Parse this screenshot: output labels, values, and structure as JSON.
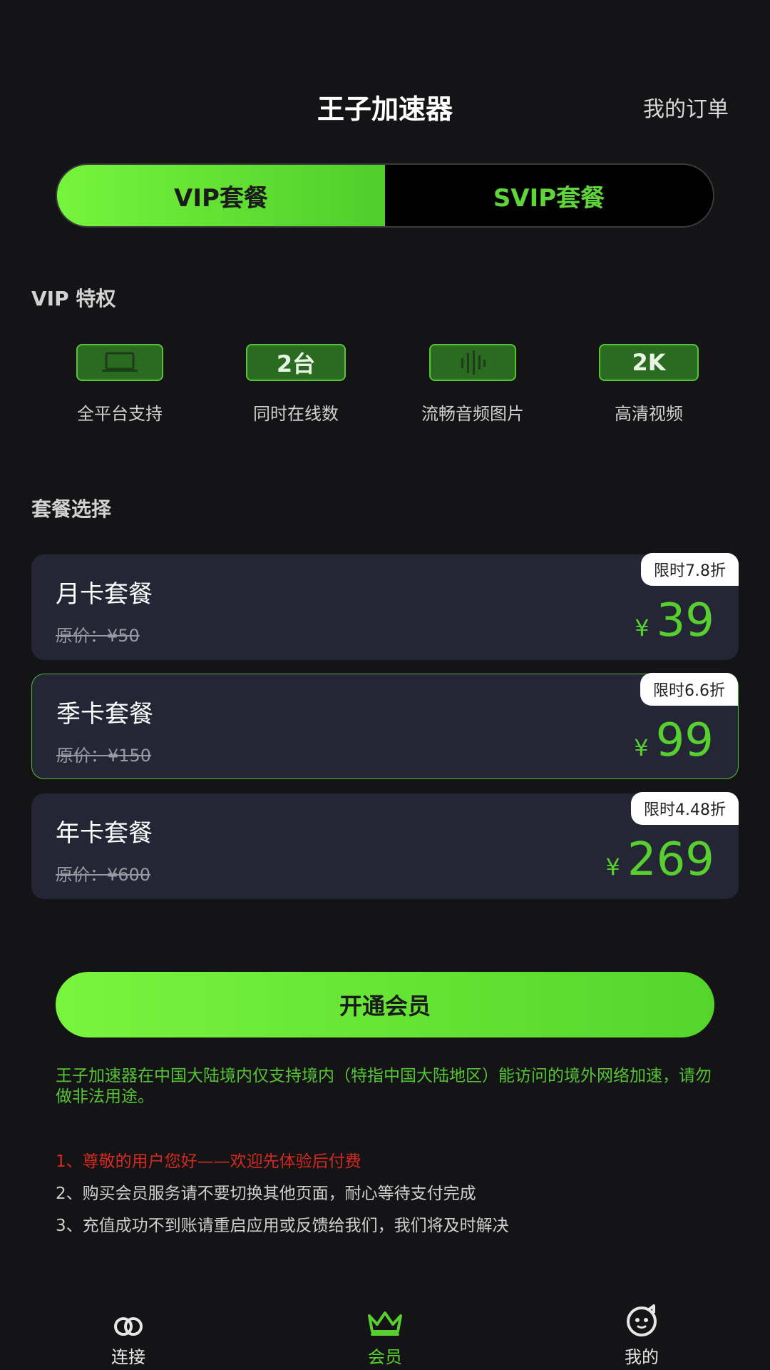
{
  "header": {
    "title": "王子加速器",
    "orders_link": "我的订单"
  },
  "tabs": [
    {
      "label": "VIP套餐",
      "active": true
    },
    {
      "label": "SVIP套餐",
      "active": false
    }
  ],
  "privileges": {
    "heading": "VIP 特权",
    "items": [
      {
        "badge": "",
        "icon": "laptop-icon",
        "label": "全平台支持"
      },
      {
        "badge": "2台",
        "icon": "",
        "label": "同时在线数"
      },
      {
        "badge": "",
        "icon": "audio-bars-icon",
        "label": "流畅音频图片"
      },
      {
        "badge": "2K",
        "icon": "",
        "label": "高清视频"
      }
    ]
  },
  "plans": {
    "heading": "套餐选择",
    "items": [
      {
        "name": "月卡套餐",
        "original": "原价：¥50",
        "currency": "¥",
        "price": "39",
        "discount": "限时7.8折",
        "selected": false
      },
      {
        "name": "季卡套餐",
        "original": "原价：¥150",
        "currency": "¥",
        "price": "99",
        "discount": "限时6.6折",
        "selected": true
      },
      {
        "name": "年卡套餐",
        "original": "原价：¥600",
        "currency": "¥",
        "price": "269",
        "discount": "限时4.48折",
        "selected": false
      }
    ]
  },
  "cta_label": "开通会员",
  "disclaimer": "王子加速器在中国大陆境内仅支持境内（特指中国大陆地区）能访问的境外网络加速，请勿做非法用途。",
  "notes": [
    "1、尊敬的用户您好——欢迎先体验后付费",
    "2、购买会员服务请不要切换其他页面，耐心等待支付完成",
    "3、充值成功不到账请重启应用或反馈给我们，我们将及时解决"
  ],
  "bottom_nav": [
    {
      "label": "连接",
      "icon": "connect-rings-icon",
      "active": false
    },
    {
      "label": "会员",
      "icon": "crown-icon",
      "active": true
    },
    {
      "label": "我的",
      "icon": "profile-face-icon",
      "active": false
    }
  ],
  "colors": {
    "accent": "#57cf2f",
    "background": "#141416",
    "card": "#242635",
    "warning": "#d22a20"
  }
}
